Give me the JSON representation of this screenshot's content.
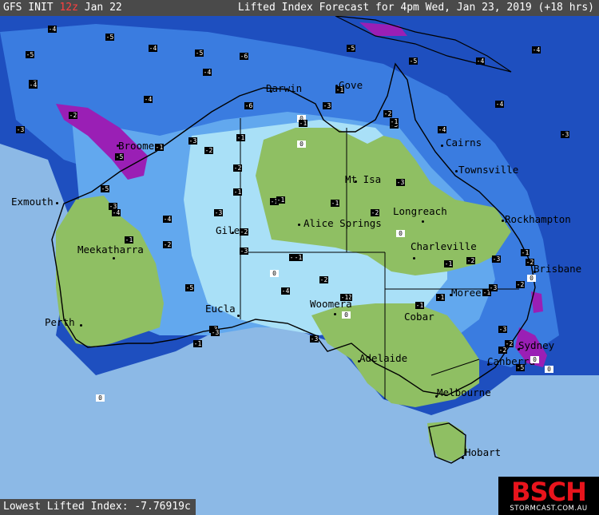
{
  "header": {
    "model": "GFS INIT",
    "init_hour": "12z",
    "init_date": "Jan 22",
    "title": "Lifted Index Forecast for 4pm Wed, Jan 23, 2019 (+18 hrs)"
  },
  "footer": {
    "stat": "Lowest Lifted Index: -7.76919c"
  },
  "logo": {
    "brand": "BSCH",
    "site": "STORMCAST.COM.AU"
  },
  "cities": [
    {
      "id": "darwin",
      "name": "Darwin"
    },
    {
      "id": "gove",
      "name": "Gove"
    },
    {
      "id": "broome",
      "name": "Broome"
    },
    {
      "id": "cairns",
      "name": "Cairns"
    },
    {
      "id": "mtisa",
      "name": "Mt Isa"
    },
    {
      "id": "townsville",
      "name": "Townsville"
    },
    {
      "id": "exmouth",
      "name": "Exmouth"
    },
    {
      "id": "longreach",
      "name": "Longreach"
    },
    {
      "id": "alicesprings",
      "name": "Alice Springs"
    },
    {
      "id": "rockhampton",
      "name": "Rockhampton"
    },
    {
      "id": "giles",
      "name": "Giles"
    },
    {
      "id": "meekatharra",
      "name": "Meekatharra"
    },
    {
      "id": "charleville",
      "name": "Charleville"
    },
    {
      "id": "brisbane",
      "name": "Brisbane"
    },
    {
      "id": "moree",
      "name": "Moree"
    },
    {
      "id": "woomera",
      "name": "Woomera"
    },
    {
      "id": "eucla",
      "name": "Eucla"
    },
    {
      "id": "cobar",
      "name": "Cobar"
    },
    {
      "id": "perth",
      "name": "Perth"
    },
    {
      "id": "sydney",
      "name": "Sydney"
    },
    {
      "id": "canberra",
      "name": "Canberra"
    },
    {
      "id": "adelaide",
      "name": "Adelaide"
    },
    {
      "id": "melbourne",
      "name": "Melbourne"
    },
    {
      "id": "hobart",
      "name": "Hobart"
    }
  ],
  "contour_labels": [
    "-4",
    "-5",
    "-4",
    "-5",
    "-6",
    "-5",
    "-5",
    "-4",
    "-4",
    "-3",
    "-5",
    "-4",
    "-6",
    "-3",
    "-5",
    "-4",
    "-4",
    "-3",
    "-2",
    "-3",
    "-4",
    "-1",
    "-3",
    "-2",
    "-2",
    "0",
    "-1",
    "-3",
    "-1",
    "-3",
    "-2",
    "-1",
    "-2",
    "-1",
    "-1",
    "-2",
    "0",
    "-3",
    "-5",
    "-3",
    "-1",
    "-1",
    "-2",
    "-2",
    "-3",
    "-4",
    "-1",
    "0",
    "0",
    "-1",
    "-1",
    "-2",
    "-3",
    "-2",
    "-2",
    "0",
    "-1",
    "-1",
    "-2",
    "-1",
    "0",
    "-1",
    "-3",
    "-4",
    "-5",
    "-4",
    "-3",
    "-2",
    "-1",
    "0",
    "-1",
    "-1",
    "-3",
    "-2",
    "-1",
    "-4",
    "-5",
    "-5",
    "-3",
    "0",
    "0"
  ],
  "colors": {
    "ocean": "#1e4fbf",
    "land_stable": "#8fbf63",
    "light_blue": "#a9e0f7",
    "mid_blue": "#62a8ee",
    "blue": "#3a7ce0",
    "purple": "#9a1fb5",
    "header_bg": "#4a4a4a",
    "logo_red": "#e8141c"
  }
}
